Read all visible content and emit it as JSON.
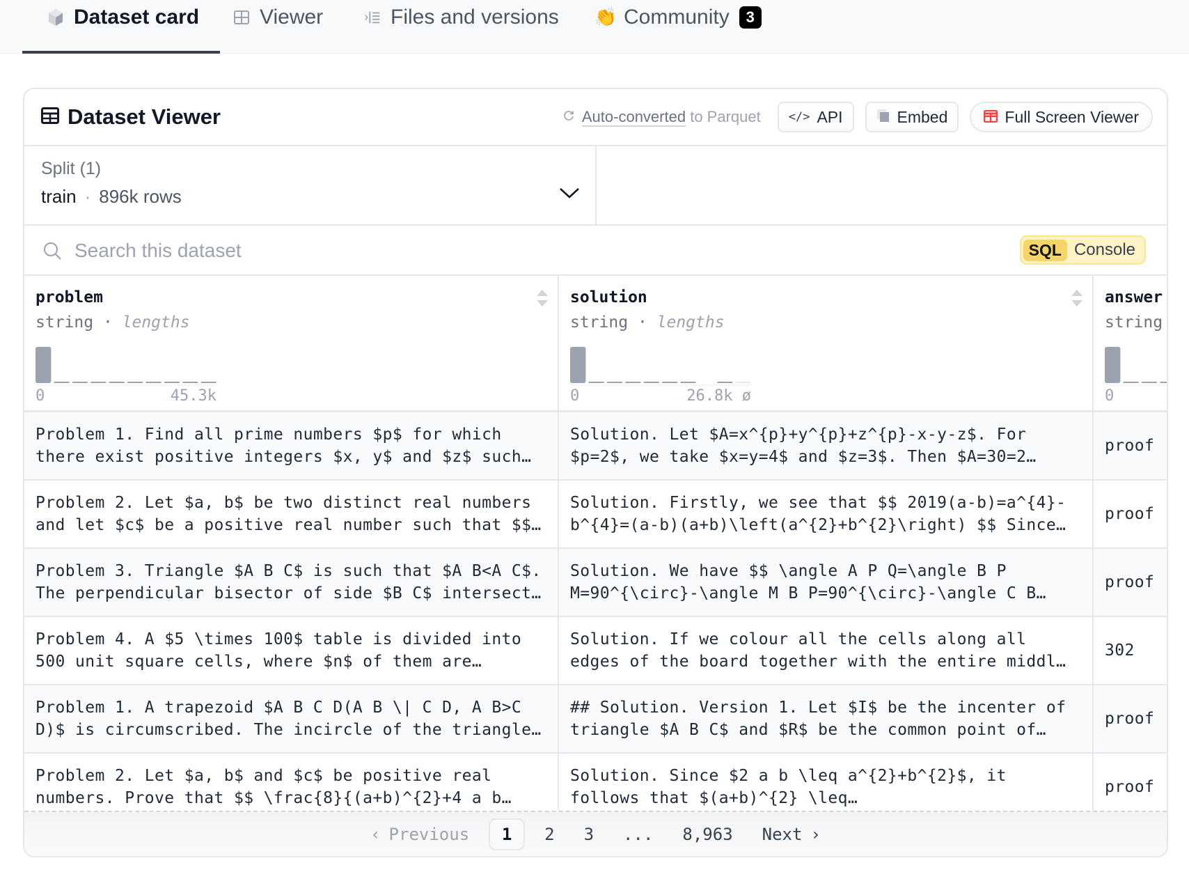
{
  "tabs": [
    {
      "label": "Dataset card",
      "icon": "cube-icon",
      "active": true
    },
    {
      "label": "Viewer",
      "icon": "table-icon",
      "active": false
    },
    {
      "label": "Files and versions",
      "icon": "files-icon",
      "active": false
    },
    {
      "label": "Community",
      "icon": "clap-hands-icon",
      "active": false,
      "badge": "3"
    }
  ],
  "viewer": {
    "title": "Dataset Viewer",
    "auto_converted_link": "Auto-converted",
    "auto_converted_suffix": "to Parquet",
    "api_label": "API",
    "embed_label": "Embed",
    "full_screen_label": "Full Screen Viewer"
  },
  "split": {
    "label": "Split (1)",
    "value": "train",
    "separator": "·",
    "rows": "896k rows"
  },
  "search": {
    "placeholder": "Search this dataset",
    "value": ""
  },
  "sql_console": {
    "tag": "SQL",
    "label": "Console"
  },
  "columns": [
    {
      "name": "problem",
      "type": "string",
      "stat": "lengths",
      "min": "0",
      "max": "45.3k",
      "hist": [
        100,
        3,
        3,
        3,
        3,
        3,
        3,
        3,
        3,
        3
      ]
    },
    {
      "name": "solution",
      "type": "string",
      "stat": "lengths",
      "min": "0",
      "max": "26.8k",
      "null_mark": "ø",
      "hist": [
        100,
        3,
        3,
        3,
        3,
        3,
        3,
        0,
        3,
        1
      ]
    },
    {
      "name": "answer",
      "type": "string",
      "stat": "",
      "min": "0",
      "max": "",
      "hist": [
        100,
        3,
        3,
        3
      ]
    }
  ],
  "rows": [
    {
      "problem": "Problem 1. Find all prime numbers $p$ for which there exist positive integers $x, y$ and $z$ such…",
      "solution": "Solution. Let $A=x^{p}+y^{p}+z^{p}-x-y-z$. For $p=2$, we take $x=y=4$ and $z=3$. Then $A=30=2…",
      "answer": "proof"
    },
    {
      "problem": "Problem 2. Let $a, b$ be two distinct real numbers and let $c$ be a positive real number such that $$…",
      "solution": "Solution. Firstly, we see that $$ 2019(a-b)=a^{4}-b^{4}=(a-b)(a+b)\\left(a^{2}+b^{2}\\right) $$ Since…",
      "answer": "proof"
    },
    {
      "problem": "Problem 3. Triangle $A B C$ is such that $A B<A C$. The perpendicular bisector of side $B C$ intersect…",
      "solution": "Solution. We have $$ \\angle A P Q=\\angle B P M=90^{\\circ}-\\angle M B P=90^{\\circ}-\\angle C B…",
      "answer": "proof"
    },
    {
      "problem": "Problem 4. A $5 \\times 100$ table is divided into 500 unit square cells, where $n$ of them are…",
      "solution": "Solution. If we colour all the cells along all edges of the board together with the entire middl…",
      "answer": "302"
    },
    {
      "problem": "Problem 1. A trapezoid $A B C D(A B \\| C D, A B>C D)$ is circumscribed. The incircle of the triangle…",
      "solution": "## Solution. Version 1. Let $I$ be the incenter of triangle $A B C$ and $R$ be the common point of…",
      "answer": "proof"
    },
    {
      "problem": "Problem 2. Let $a, b$ and $c$ be positive real numbers. Prove that $$ \\frac{8}{(a+b)^{2}+4 a b…",
      "solution": "Solution. Since $2 a b \\leq a^{2}+b^{2}$, it follows that $(a+b)^{2} \\leq…",
      "answer": "proof"
    }
  ],
  "pagination": {
    "previous": "Previous",
    "pages": [
      "1",
      "2",
      "3"
    ],
    "ellipsis": "...",
    "last": "8,963",
    "next": "Next",
    "current": "1"
  }
}
